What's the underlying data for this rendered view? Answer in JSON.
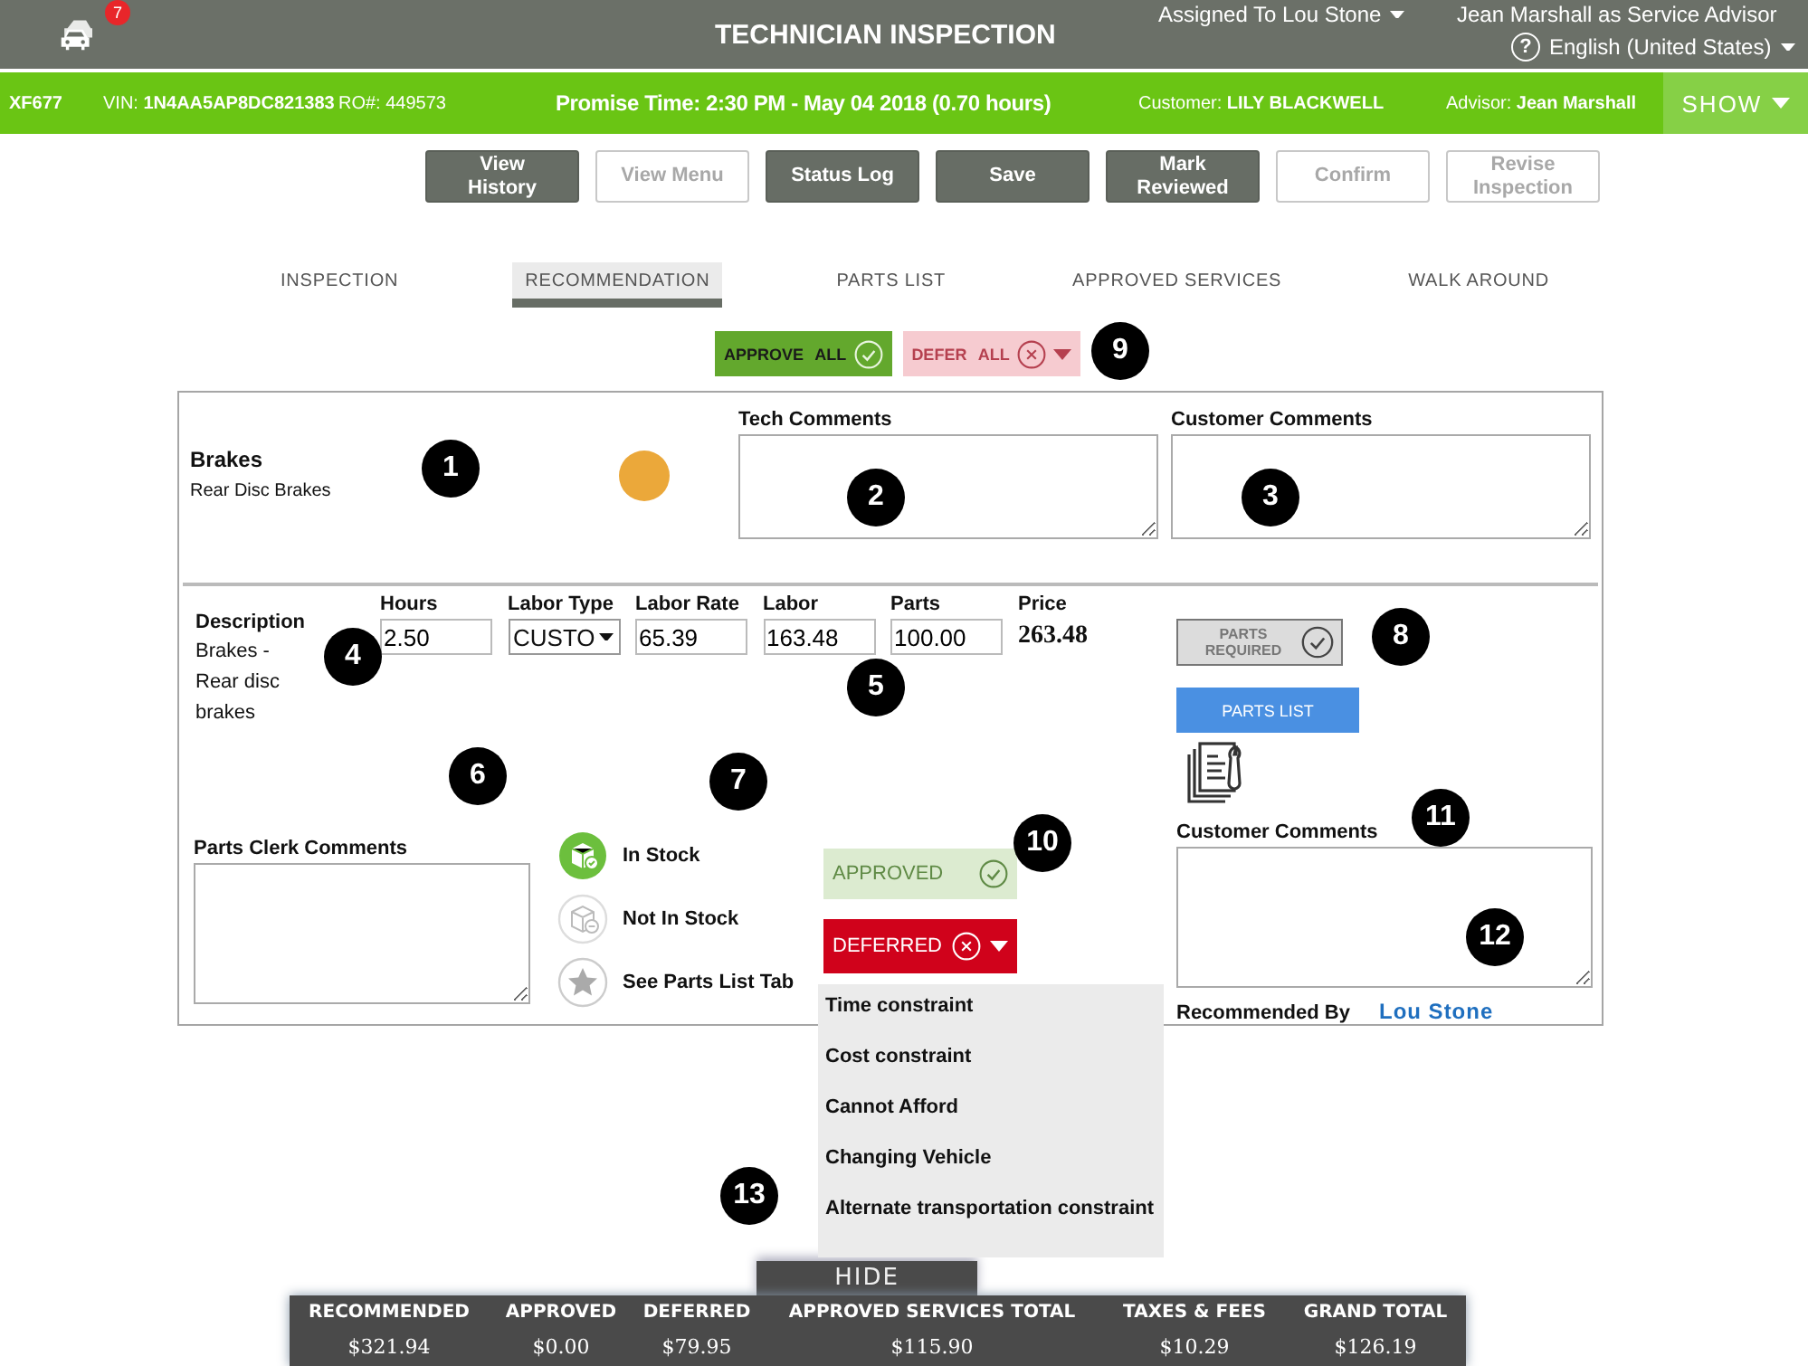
{
  "header": {
    "notification_count": "7",
    "title": "TECHNICIAN INSPECTION",
    "assigned": "Assigned To Lou Stone",
    "user": "Jean Marshall as Service Advisor",
    "help": "?",
    "language": "English (United States)"
  },
  "info_bar": {
    "tag": "XF677",
    "vin": "VIN: **1N4AA5AP8DC821383**",
    "ro": "RO#: 449573",
    "promise": "Promise Time: 2:30 PM - May 04 2018 (0.70 hours)",
    "customer": "Customer: **LILY BLACKWELL**",
    "advisor": "Advisor: **Jean Marshall**",
    "show_button": "SHOW"
  },
  "actions": [
    {
      "label": "View History",
      "disabled": false
    },
    {
      "label": "View Menu",
      "disabled": true
    },
    {
      "label": "Status Log",
      "disabled": false
    },
    {
      "label": "Save",
      "disabled": false
    },
    {
      "label": "Mark Reviewed",
      "disabled": false
    },
    {
      "label": "Confirm",
      "disabled": true
    },
    {
      "label": "Revise Inspection",
      "disabled": true
    }
  ],
  "tabs": [
    {
      "label": "INSPECTION",
      "selected": false
    },
    {
      "label": "RECOMMENDATION",
      "selected": true
    },
    {
      "label": "PARTS LIST",
      "selected": false
    },
    {
      "label": "APPROVED SERVICES",
      "selected": false
    },
    {
      "label": "WALK AROUND",
      "selected": false
    }
  ],
  "bulk_actions": [
    {
      "label": "APPROVE ALL",
      "kind": "approve",
      "disabled": false
    },
    {
      "label": "DEFER ALL",
      "kind": "defer",
      "disabled": true
    }
  ],
  "recommendation": {
    "title": "Brakes",
    "subtitle": "Rear Disc Brakes",
    "status": {
      "color": "#eba83a"
    },
    "tech_comments_label": "Tech Comments",
    "customer_comments_label": "Customer Comments",
    "description_label": "Description",
    "description": "Brakes - Rear disc brakes",
    "fields": [
      {
        "label": "Hours",
        "value": "2.50",
        "kind": "input"
      },
      {
        "label": "Labor Type",
        "value": "CUSTO",
        "kind": "select"
      },
      {
        "label": "Labor Rate",
        "value": "65.39",
        "kind": "input"
      },
      {
        "label": "Labor",
        "value": "163.48",
        "kind": "input"
      },
      {
        "label": "Parts",
        "value": "100.00",
        "kind": "input"
      },
      {
        "label": "Price",
        "value": "263.48",
        "kind": "total"
      }
    ],
    "parts_required_button": "PARTS REQUIRED",
    "parts_list_button": "PARTS LIST",
    "parts_clerk_label": "Parts Clerk Comments",
    "stock_legend": [
      {
        "label": "In Stock",
        "kind": "in-stock"
      },
      {
        "label": "Not In Stock",
        "kind": "not-in-stock"
      },
      {
        "label": "See Parts List Tab",
        "kind": "parts-list"
      }
    ],
    "decisions": [
      {
        "label": "APPROVED",
        "kind": "approve",
        "selected": false
      },
      {
        "label": "DEFERRED",
        "kind": "defer",
        "selected": true
      }
    ],
    "defer_reasons": [
      "Time constraint",
      "Cost constraint",
      "Cannot Afford",
      "Changing Vehicle",
      "Alternate transportation constraint"
    ],
    "customer_comments_label_2": "Customer Comments",
    "recommended_by_label": "Recommended By",
    "recommended_by": "Lou Stone"
  },
  "summary": {
    "hide_button": "HIDE",
    "columns": [
      {
        "label": "RECOMMENDED",
        "value": "$321.94"
      },
      {
        "label": "APPROVED",
        "value": "$0.00"
      },
      {
        "label": "DEFERRED",
        "value": "$79.95"
      },
      {
        "label": "APPROVED SERVICES TOTAL",
        "value": "$115.90"
      },
      {
        "label": "TAXES & FEES",
        "value": "$10.29"
      },
      {
        "label": "GRAND TOTAL",
        "value": "$126.19"
      }
    ]
  },
  "callouts": [
    "1",
    "2",
    "3",
    "4",
    "5",
    "6",
    "7",
    "8",
    "9",
    "10",
    "11",
    "12",
    "13"
  ]
}
